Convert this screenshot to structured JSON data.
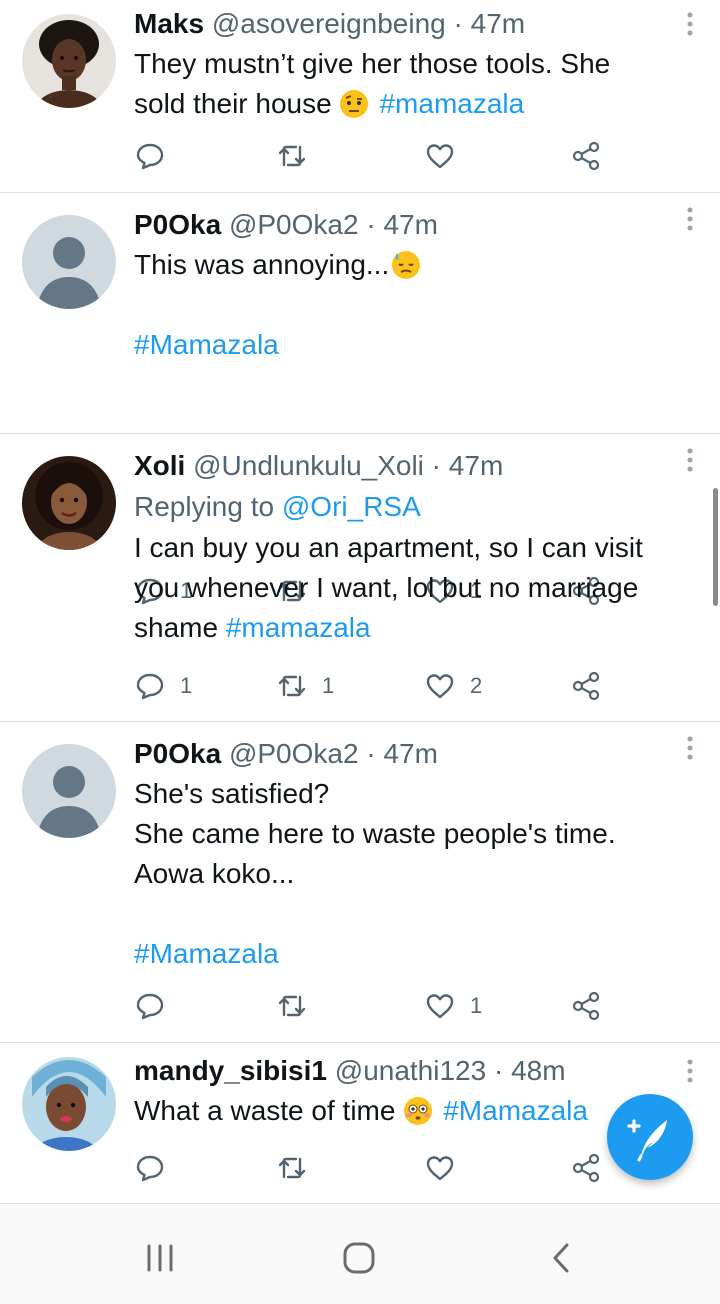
{
  "tweets": [
    {
      "name": "Maks",
      "handle": "@asovereignbeing",
      "time": "47m",
      "text_lines": [
        "They mustn’t give her those tools. She",
        "sold their house "
      ],
      "emoji": "face-with-raised-eyebrow",
      "hashtag": "#mamazala",
      "counts": {
        "reply": "",
        "retweet": "",
        "like": ""
      }
    },
    {
      "name": "P0Oka",
      "handle": "@P0Oka2",
      "time": "47m",
      "text": "This was annoying...",
      "emoji": "downcast-face-with-sweat",
      "hashtag": "#Mamazala",
      "counts": {
        "reply": "1",
        "retweet": "",
        "like": "1"
      }
    },
    {
      "name": "Xoli",
      "handle": "@Undlunkulu_Xoli",
      "time": "47m",
      "replying_prefix": "Replying to ",
      "replying_to": "@Ori_RSA",
      "text_lines": [
        "I can buy you an apartment, so I can visit",
        "you whenever I want, lol but no marriage",
        "shame "
      ],
      "hashtag": "#mamazala",
      "counts": {
        "reply": "1",
        "retweet": "1",
        "like": "2"
      }
    },
    {
      "name": "P0Oka",
      "handle": "@P0Oka2",
      "time": "47m",
      "text_lines": [
        "She's satisfied?",
        "She came here to waste people's time.",
        "Aowa koko..."
      ],
      "hashtag": "#Mamazala",
      "counts": {
        "reply": "",
        "retweet": "",
        "like": "1"
      }
    },
    {
      "name": "mandy_sibisi1",
      "handle": "@unathi123",
      "time": "48m",
      "text": "What a waste of time ",
      "emoji": "flushed-face",
      "hashtag": "#Mamazala",
      "counts": {
        "reply": "",
        "retweet": "",
        "like": ""
      }
    }
  ],
  "separator": " · ",
  "icons": {
    "reply": "reply-icon",
    "retweet": "retweet-icon",
    "like": "heart-icon",
    "share": "share-icon",
    "more": "more-vertical-icon",
    "compose": "compose-feather-icon"
  },
  "system_nav": [
    "recent-apps-icon",
    "home-icon",
    "back-icon"
  ],
  "colors": {
    "accent": "#1d9bf0",
    "text": "#0f1419",
    "secondary": "#536471",
    "divider": "#dcdfe2"
  }
}
